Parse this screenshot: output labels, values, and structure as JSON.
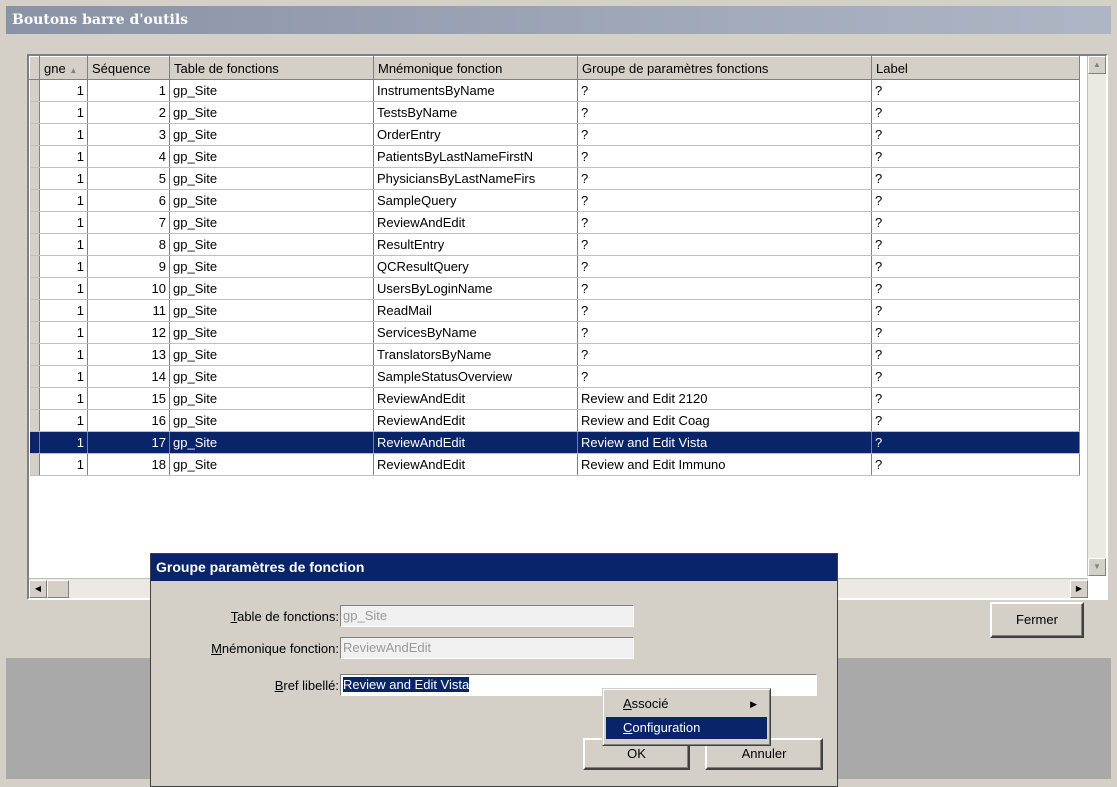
{
  "window": {
    "title": "Boutons barre d'outils"
  },
  "grid": {
    "columns": [
      "gne",
      "Séquence",
      "Table de fonctions",
      "Mnémonique fonction",
      "Groupe de paramètres fonctions",
      "Label"
    ],
    "rows": [
      [
        "1",
        "1",
        "gp_Site",
        "InstrumentsByName",
        "?",
        "?"
      ],
      [
        "1",
        "2",
        "gp_Site",
        "TestsByName",
        "?",
        "?"
      ],
      [
        "1",
        "3",
        "gp_Site",
        "OrderEntry",
        "?",
        "?"
      ],
      [
        "1",
        "4",
        "gp_Site",
        "PatientsByLastNameFirstN",
        "?",
        "?"
      ],
      [
        "1",
        "5",
        "gp_Site",
        "PhysiciansByLastNameFirs",
        "?",
        "?"
      ],
      [
        "1",
        "6",
        "gp_Site",
        "SampleQuery",
        "?",
        "?"
      ],
      [
        "1",
        "7",
        "gp_Site",
        "ReviewAndEdit",
        "?",
        "?"
      ],
      [
        "1",
        "8",
        "gp_Site",
        "ResultEntry",
        "?",
        "?"
      ],
      [
        "1",
        "9",
        "gp_Site",
        "QCResultQuery",
        "?",
        "?"
      ],
      [
        "1",
        "10",
        "gp_Site",
        "UsersByLoginName",
        "?",
        "?"
      ],
      [
        "1",
        "11",
        "gp_Site",
        "ReadMail",
        "?",
        "?"
      ],
      [
        "1",
        "12",
        "gp_Site",
        "ServicesByName",
        "?",
        "?"
      ],
      [
        "1",
        "13",
        "gp_Site",
        "TranslatorsByName",
        "?",
        "?"
      ],
      [
        "1",
        "14",
        "gp_Site",
        "SampleStatusOverview",
        "?",
        "?"
      ],
      [
        "1",
        "15",
        "gp_Site",
        "ReviewAndEdit",
        "Review and Edit 2120",
        "?"
      ],
      [
        "1",
        "16",
        "gp_Site",
        "ReviewAndEdit",
        "Review and Edit Coag",
        "?"
      ],
      [
        "1",
        "17",
        "gp_Site",
        "ReviewAndEdit",
        "Review and Edit Vista",
        "?"
      ],
      [
        "1",
        "18",
        "gp_Site",
        "ReviewAndEdit",
        "Review and Edit Immuno",
        "?"
      ]
    ],
    "selected_row": 17
  },
  "close_button": "Fermer",
  "dialog": {
    "title": "Groupe paramètres de fonction",
    "table_label_ul": "T",
    "table_label_rest": "able de fonctions:",
    "table_value": "gp_Site",
    "mnemonic_label_ul": "M",
    "mnemonic_label_rest": "némonique fonction:",
    "mnemonic_value": "ReviewAndEdit",
    "short_label_ul": "B",
    "short_label_rest": "ref libellé:",
    "short_value": "Review and Edit Vista",
    "ok": "OK",
    "cancel": "Annuler"
  },
  "context_menu": {
    "items": [
      {
        "ul": "A",
        "rest": "ssocié",
        "submenu": true
      },
      {
        "ul": "C",
        "rest": "onfiguration",
        "submenu": false
      }
    ],
    "hover_index": 1
  },
  "icons": {
    "sort_asc": "sort-ascending-icon",
    "scroll_up": "scroll-up-arrow-icon",
    "scroll_down": "scroll-down-arrow-icon",
    "scroll_left": "scroll-left-arrow-icon",
    "scroll_right": "scroll-right-arrow-icon",
    "submenu": "submenu-arrow-icon"
  }
}
